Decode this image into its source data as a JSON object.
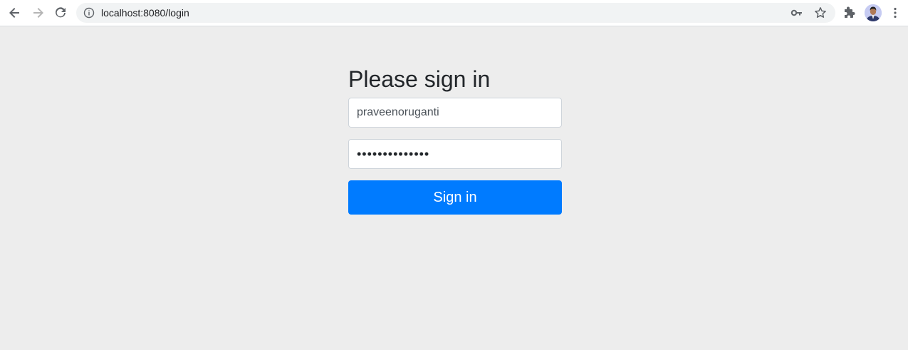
{
  "browser": {
    "url": "localhost:8080/login",
    "icons": [
      "back-arrow-icon",
      "forward-arrow-icon",
      "reload-icon",
      "info-icon",
      "key-icon",
      "star-icon",
      "extensions-icon",
      "avatar",
      "more-vert-icon"
    ]
  },
  "login": {
    "title": "Please sign in",
    "username_value": "praveenoruganti",
    "password_value": "••••••••••••••",
    "submit_label": "Sign in"
  },
  "colors": {
    "primary": "#007bff",
    "page_bg": "#ededed"
  }
}
